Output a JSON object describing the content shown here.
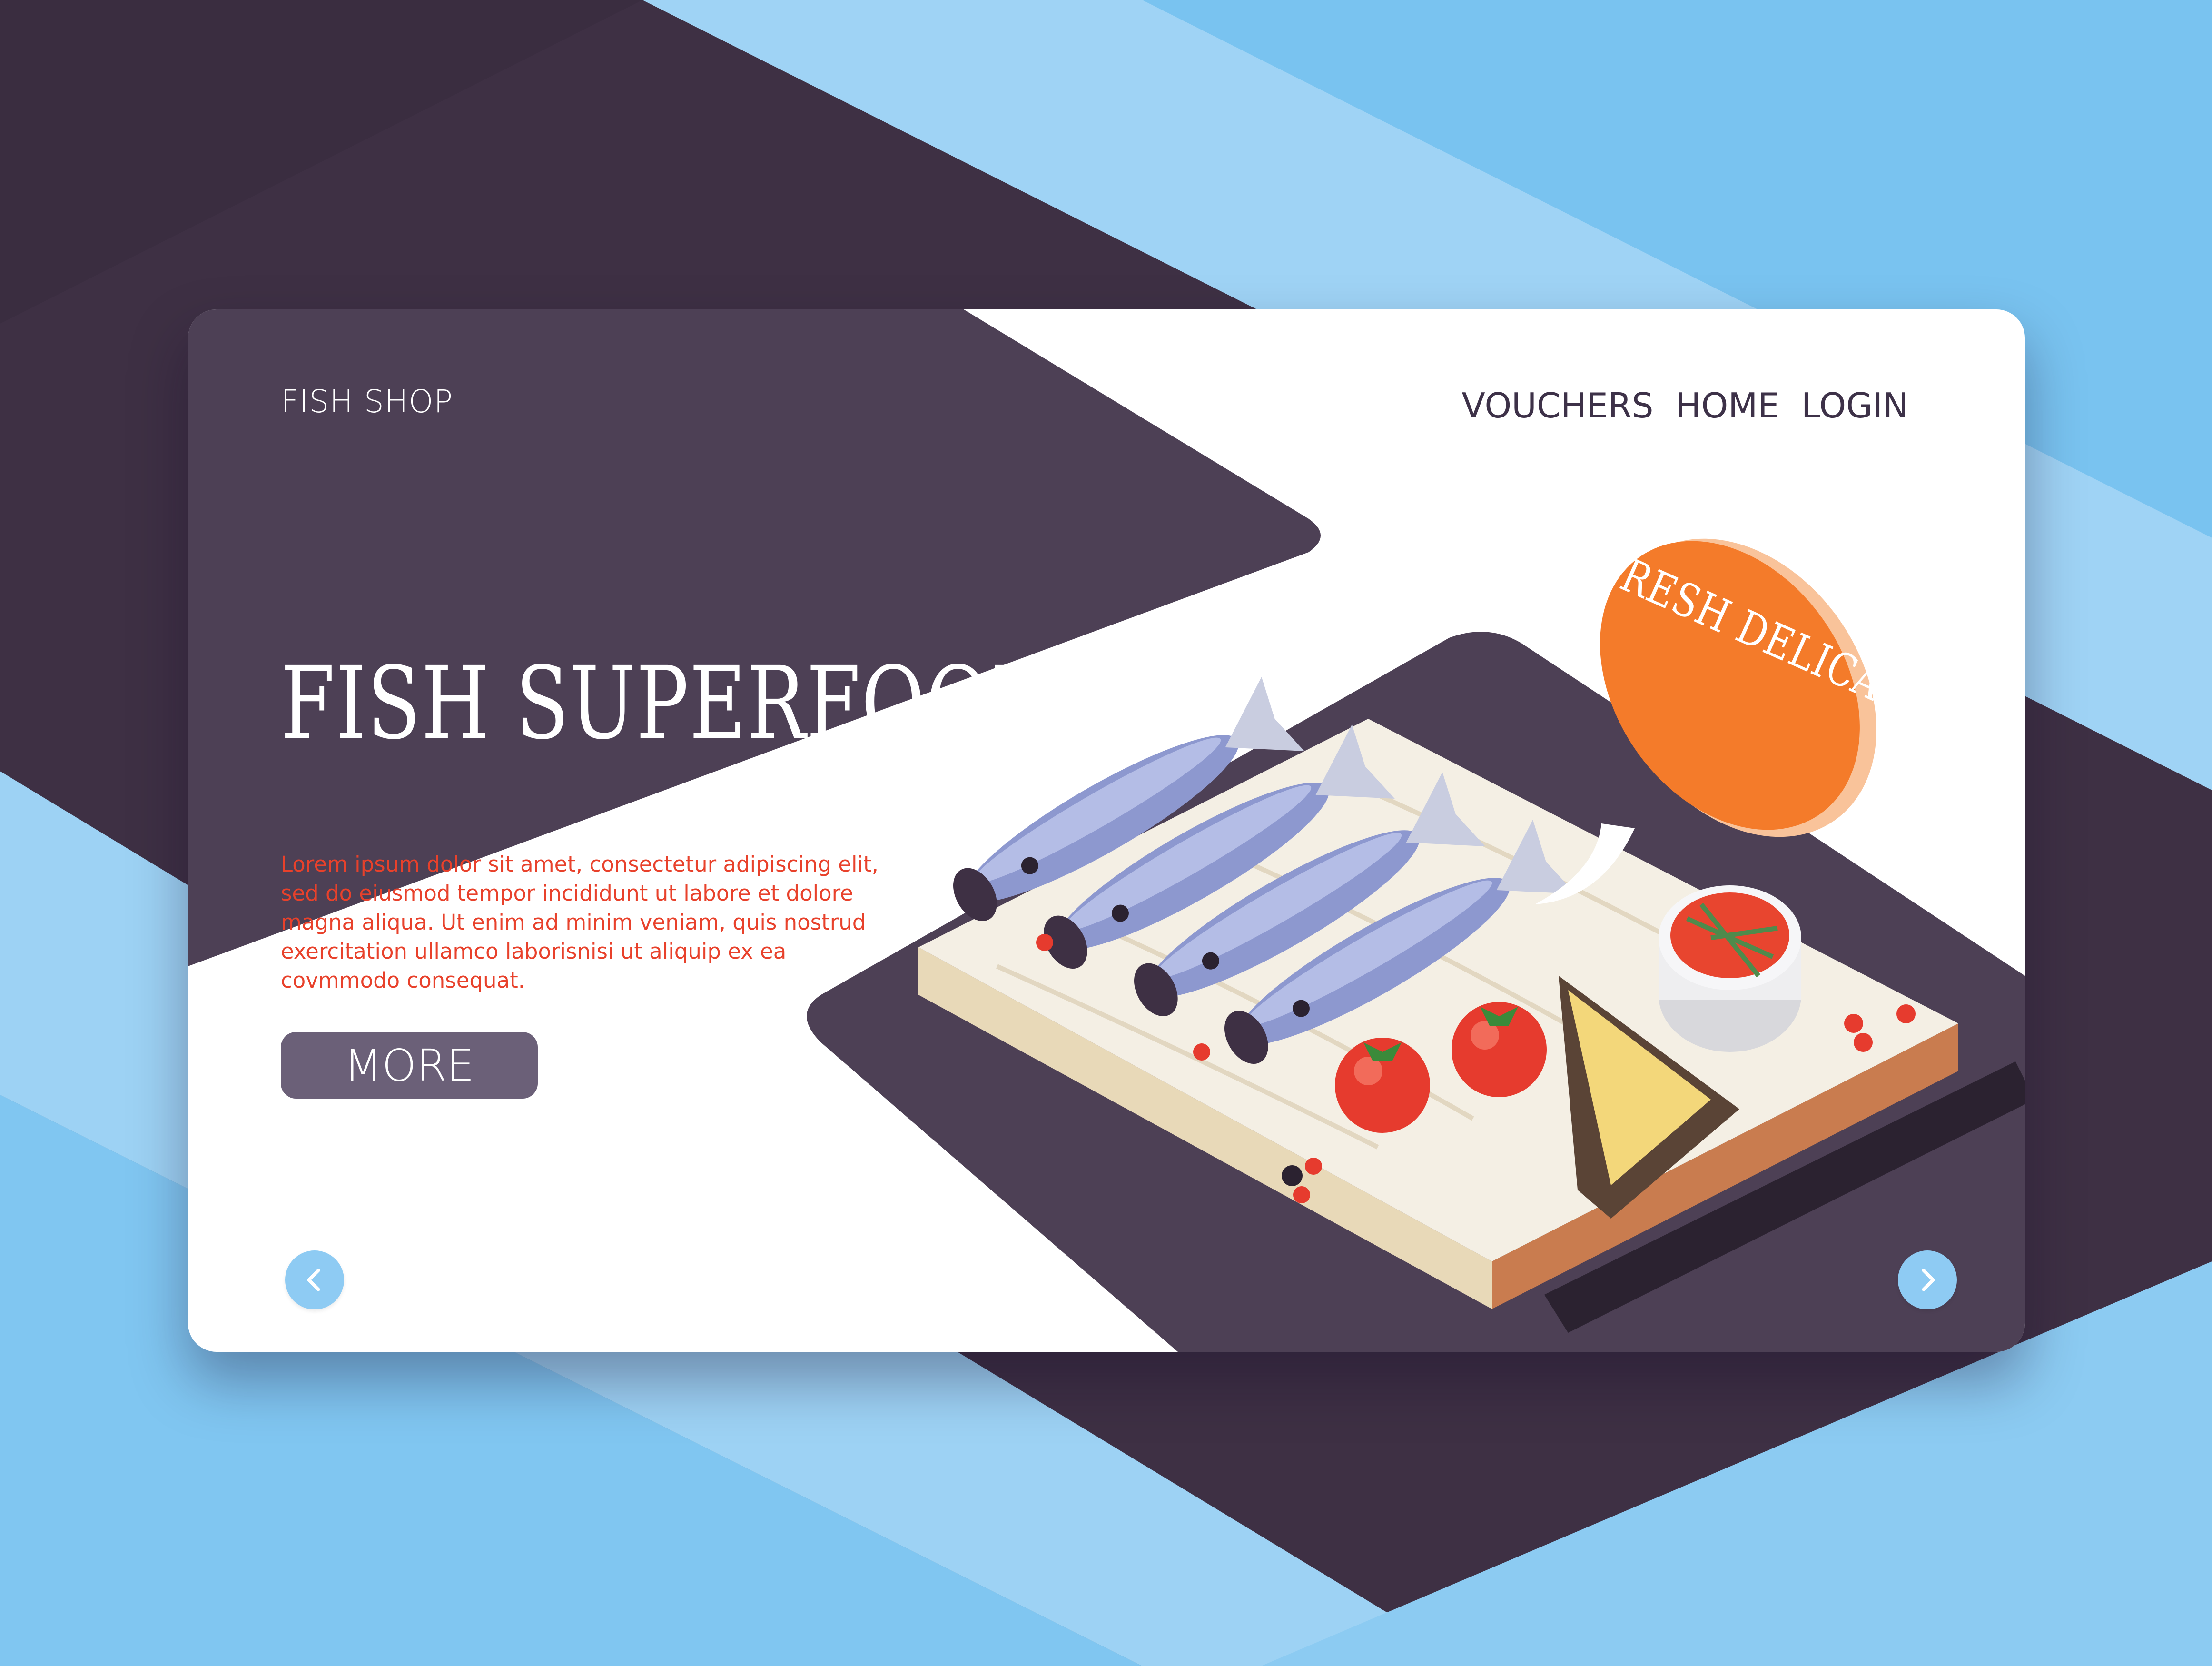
{
  "brand": "FISH SHOP",
  "nav": [
    "VOUCHERS",
    "HOME",
    "LOGIN"
  ],
  "hero": {
    "title": "FISH SUPERFOOD",
    "body": "Lorem ipsum dolor sit amet, consectetur adipiscing elit, sed do eiusmod tempor incididunt ut labore et dolore magna aliqua. Ut enim ad minim veniam, quis nostrud exercitation ullamco laborisnisi ut aliquip ex ea covmmodo consequat.",
    "more_label": "MORE"
  },
  "bubble": {
    "label": "FRESH DELICACIES"
  },
  "controls": {
    "prev_icon": "chevron-left-icon",
    "next_icon": "chevron-right-icon"
  },
  "colors": {
    "background_light": "#aad9f7",
    "background_dark": "#3e3044",
    "card_panel": "#4d4055",
    "title_text": "#ffffff",
    "body_text": "#e8412b",
    "button": "#6b6078",
    "arrow_button": "#8ecbf3",
    "bubble": "#f47b2a",
    "fish": "#8d98cf"
  }
}
